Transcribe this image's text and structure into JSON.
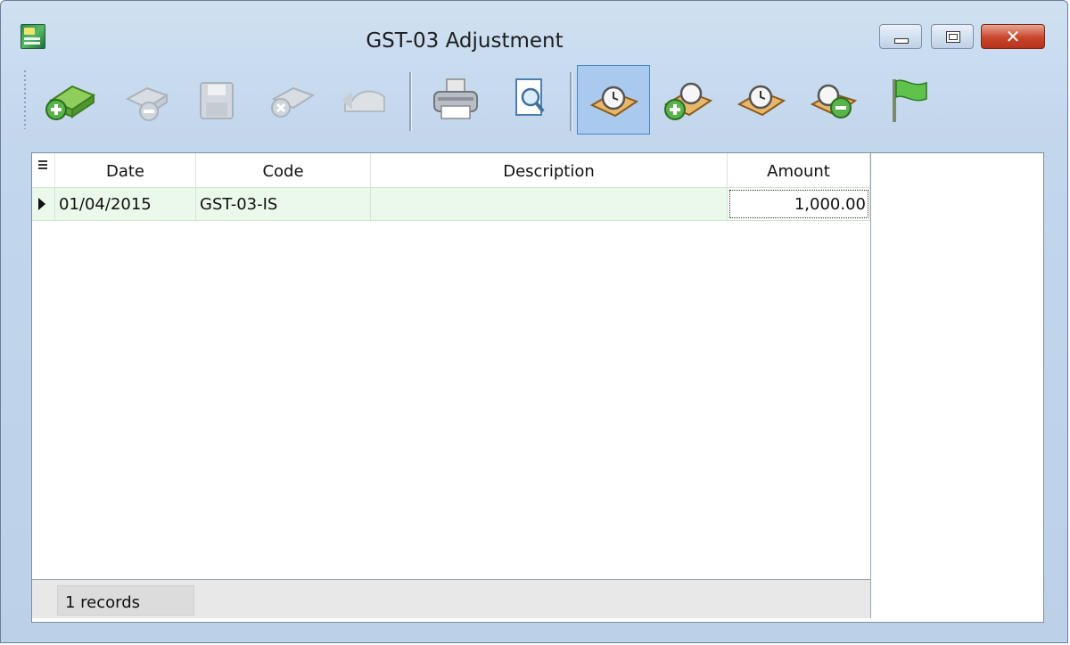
{
  "window": {
    "title": "GST-03 Adjustment",
    "controls": [
      "minimize",
      "maximize",
      "close"
    ]
  },
  "toolbar": {
    "buttons": [
      {
        "name": "new-button",
        "icon": "money-plus-icon",
        "enabled": true
      },
      {
        "name": "delete-button",
        "icon": "money-minus-icon",
        "enabled": false
      },
      {
        "name": "save-button",
        "icon": "floppy-disk-icon",
        "enabled": false
      },
      {
        "name": "cancel-button",
        "icon": "money-cancel-icon",
        "enabled": false
      },
      {
        "name": "undo-button",
        "icon": "undo-icon",
        "enabled": false
      },
      {
        "name": "print-button",
        "icon": "printer-icon",
        "enabled": true
      },
      {
        "name": "preview-button",
        "icon": "print-preview-icon",
        "enabled": true
      },
      {
        "name": "period-button",
        "icon": "clock-tray-icon",
        "enabled": true,
        "active": true
      },
      {
        "name": "add-period-button",
        "icon": "clock-plus-icon",
        "enabled": true
      },
      {
        "name": "edit-period-button",
        "icon": "clock-tray-icon",
        "enabled": true
      },
      {
        "name": "remove-period-button",
        "icon": "clock-minus-icon",
        "enabled": true
      },
      {
        "name": "flag-button",
        "icon": "green-flag-icon",
        "enabled": true
      }
    ]
  },
  "grid": {
    "columns": [
      "Date",
      "Code",
      "Description",
      "Amount"
    ],
    "rows": [
      {
        "date": "01/04/2015",
        "code": "GST-03-IS",
        "description": "",
        "amount": "1,000.00"
      }
    ],
    "footer": {
      "records_label": "1 records"
    }
  },
  "colors": {
    "selected_row": "#eaf9ea",
    "window_bg": "#c2d6ec",
    "active_button": "#a9c9ef",
    "close_button": "#c9452c"
  }
}
